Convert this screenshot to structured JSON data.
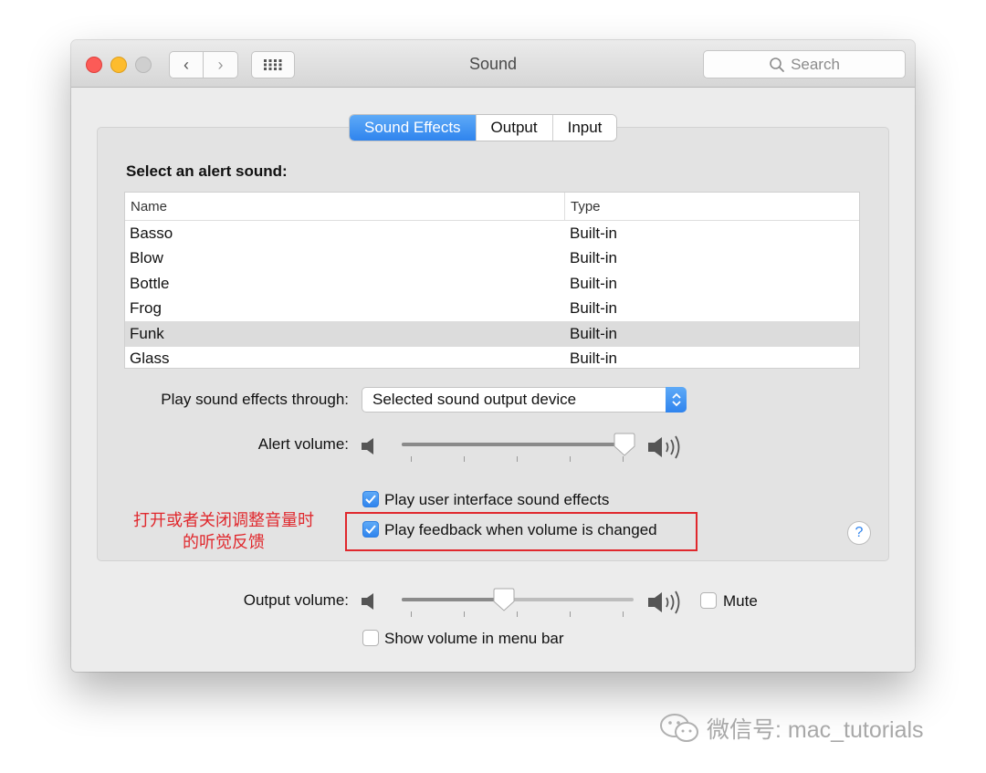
{
  "window": {
    "title": "Sound"
  },
  "search": {
    "placeholder": "Search"
  },
  "tabs": [
    {
      "label": "Sound Effects",
      "active": true
    },
    {
      "label": "Output",
      "active": false
    },
    {
      "label": "Input",
      "active": false
    }
  ],
  "sound_effects": {
    "section_label": "Select an alert sound:",
    "table": {
      "columns": [
        "Name",
        "Type"
      ],
      "rows": [
        {
          "name": "Basso",
          "type": "Built-in"
        },
        {
          "name": "Blow",
          "type": "Built-in"
        },
        {
          "name": "Bottle",
          "type": "Built-in"
        },
        {
          "name": "Frog",
          "type": "Built-in"
        },
        {
          "name": "Funk",
          "type": "Built-in",
          "selected": true
        },
        {
          "name": "Glass",
          "type": "Built-in"
        }
      ]
    },
    "play_through": {
      "label": "Play sound effects through:",
      "value": "Selected sound output device"
    },
    "alert_volume": {
      "label": "Alert volume:",
      "level": 0.96
    },
    "ui_sounds": {
      "label": "Play user interface sound effects",
      "checked": true
    },
    "feedback": {
      "label": "Play feedback when volume is changed",
      "checked": true
    }
  },
  "annotation": {
    "line1": "打开或者关闭调整音量时",
    "line2": "的听觉反馈"
  },
  "help": {
    "label": "?"
  },
  "output": {
    "volume_label": "Output volume:",
    "level": 0.44,
    "mute": {
      "label": "Mute",
      "checked": false
    },
    "menu_bar": {
      "label": "Show volume in menu bar",
      "checked": false
    }
  },
  "watermark": {
    "text": "微信号: mac_tutorials"
  },
  "colors": {
    "accent": "#2f84ee",
    "annotation": "#e0282d",
    "close": "#fc5b57",
    "minimize": "#fdbc2e"
  }
}
